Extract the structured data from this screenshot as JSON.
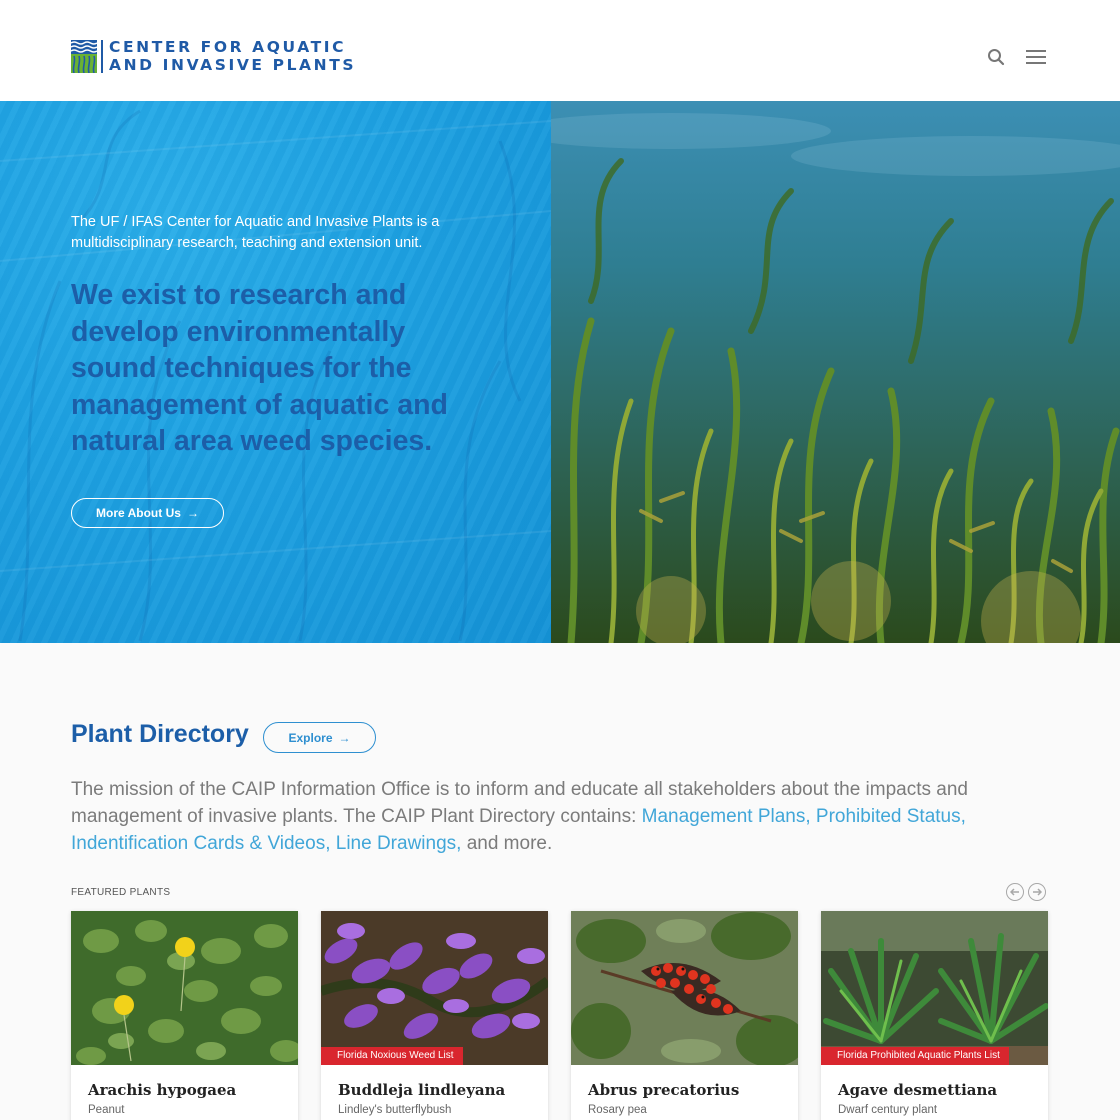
{
  "header": {
    "logo_line1": "CENTER FOR AQUATIC",
    "logo_line2": "AND INVASIVE PLANTS",
    "search_icon": "search-icon",
    "menu_icon": "hamburger-menu-icon"
  },
  "hero": {
    "intro": "The UF / IFAS Center for Aquatic and Invasive Plants is a multidisciplinary research, teaching and extension unit.",
    "headline": "We exist to research and develop environmentally sound techniques for the management of aquatic and natural area weed species.",
    "button_label": "More About Us"
  },
  "directory": {
    "title": "Plant Directory",
    "explore_label": "Explore",
    "mission_text": "The mission of the CAIP Information Office is to inform and educate all stakeholders about the impacts and management of invasive plants. The CAIP Plant Directory contains: ",
    "links": [
      "Management Plans,",
      "Prohibited Status,",
      "Indentification Cards & Videos,",
      "Line Drawings,"
    ],
    "mission_end": " and more.",
    "featured_label": "FEATURED PLANTS"
  },
  "cards": [
    {
      "title": "Arachis hypogaea",
      "subtitle": "Peanut",
      "badge": ""
    },
    {
      "title": "Buddleja lindleyana",
      "subtitle": "Lindley's butterflybush",
      "badge": "Florida Noxious Weed List"
    },
    {
      "title": "Abrus precatorius",
      "subtitle": "Rosary pea",
      "badge": ""
    },
    {
      "title": "Agave desmettiana",
      "subtitle": "Dwarf century plant",
      "badge": "Florida Prohibited Aquatic Plants List"
    }
  ],
  "colors": {
    "brand_blue": "#1c5ea8",
    "hero_blue": "#1ea2e2",
    "link_blue": "#41a6d8",
    "badge_red": "#d9262e"
  }
}
